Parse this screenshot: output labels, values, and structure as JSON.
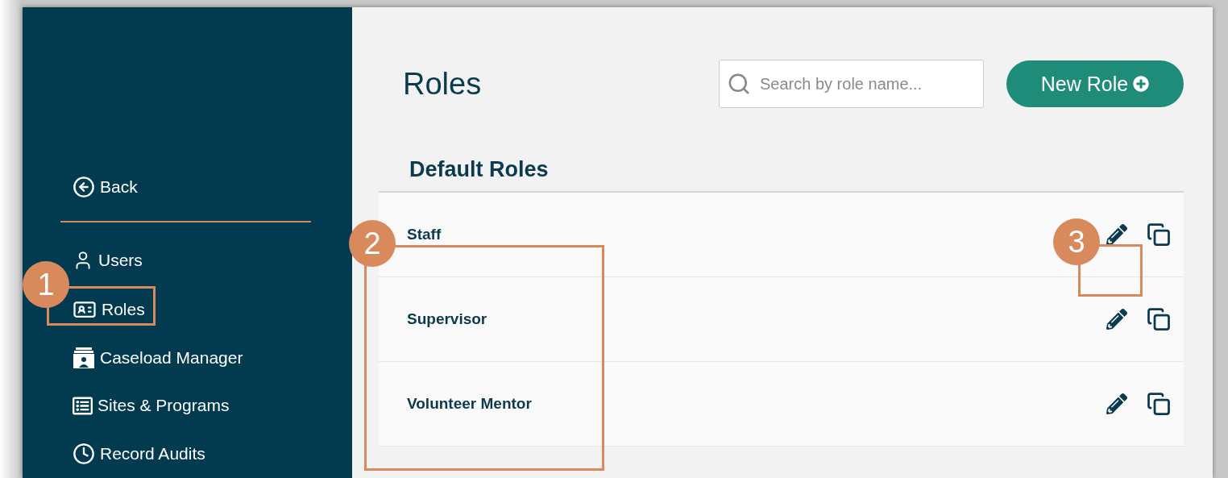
{
  "sidebar": {
    "back": "Back",
    "items": [
      {
        "label": "Users"
      },
      {
        "label": "Roles"
      },
      {
        "label": "Caseload Manager"
      },
      {
        "label": "Sites & Programs"
      },
      {
        "label": "Record Audits"
      }
    ]
  },
  "header": {
    "title": "Roles",
    "search": {
      "placeholder": "Search by role name..."
    },
    "new_button": "New Role"
  },
  "section": {
    "title": "Default Roles",
    "rows": [
      {
        "name": "Staff"
      },
      {
        "name": "Supervisor"
      },
      {
        "name": "Volunteer Mentor"
      }
    ]
  },
  "callouts": [
    {
      "number": "1"
    },
    {
      "number": "2"
    },
    {
      "number": "3"
    }
  ]
}
